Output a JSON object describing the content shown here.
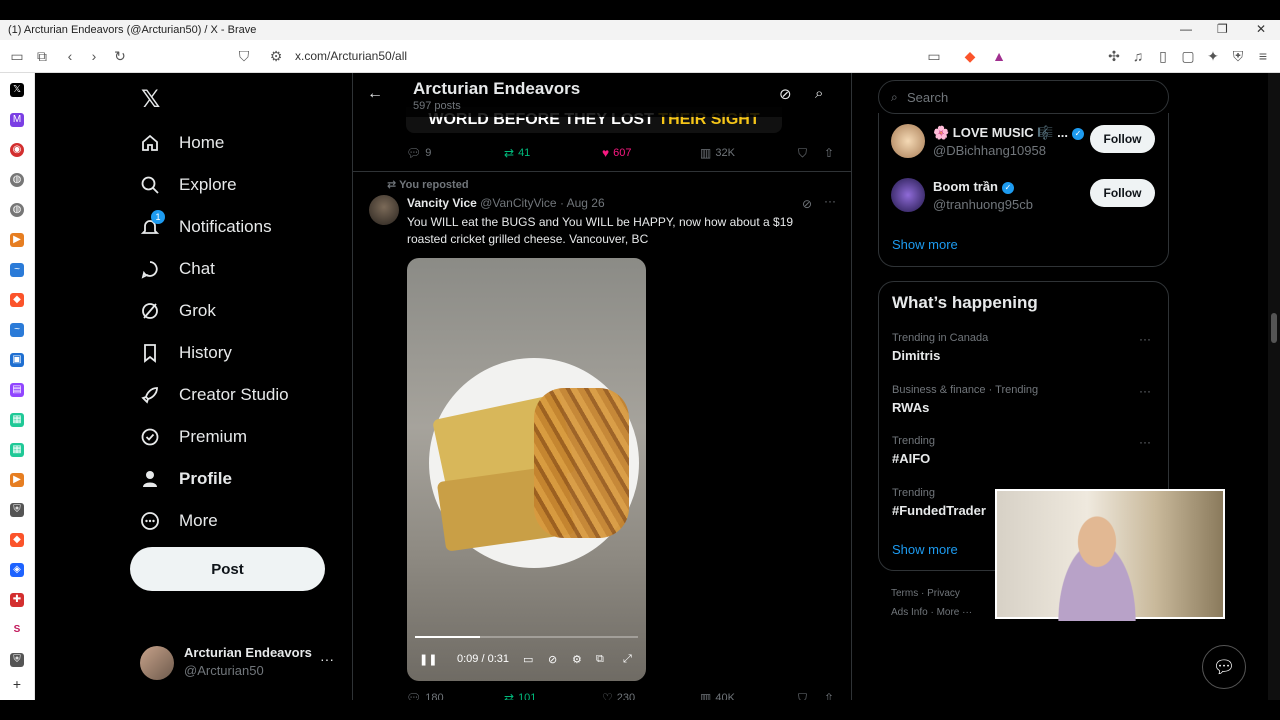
{
  "browser": {
    "window_title": "(1) Arcturian Endeavors (@Arcturian50) / X - Brave",
    "url": "x.com/Arcturian50/all"
  },
  "nav": {
    "items": [
      {
        "label": "Home",
        "icon": "home-icon"
      },
      {
        "label": "Explore",
        "icon": "search-icon"
      },
      {
        "label": "Notifications",
        "icon": "bell-icon",
        "badge": "1"
      },
      {
        "label": "Chat",
        "icon": "chat-icon"
      },
      {
        "label": "Grok",
        "icon": "grok-icon"
      },
      {
        "label": "History",
        "icon": "bookmark-icon"
      },
      {
        "label": "Creator Studio",
        "icon": "rocket-icon"
      },
      {
        "label": "Premium",
        "icon": "verified-badge-icon"
      },
      {
        "label": "Profile",
        "icon": "person-icon"
      },
      {
        "label": "More",
        "icon": "more-circle-icon"
      }
    ],
    "post_label": "Post",
    "account": {
      "name": "Arcturian Endeavors",
      "handle": "@Arcturian50"
    }
  },
  "profile_header": {
    "name": "Arcturian Endeavors",
    "post_count": "597 posts"
  },
  "prev_tweet": {
    "banner_text": "WORLD BEFORE THEY LOST ",
    "banner_highlight": "THEIR SIGHT",
    "replies": "9",
    "reposts": "41",
    "likes": "607",
    "views": "32K"
  },
  "tweet": {
    "repost_label": "You reposted",
    "author_name": "Vancity Vice",
    "author_handle": "@VanCityVice",
    "date": "· Aug 26",
    "text": "You WILL eat the BUGS and You WILL be HAPPY, now how about a $19 roasted cricket grilled cheese. Vancouver, BC",
    "video_time": "0:09 / 0:31",
    "video_progress": 0.29,
    "replies": "180",
    "reposts": "101",
    "likes": "230",
    "views": "40K"
  },
  "search": {
    "placeholder": "Search"
  },
  "who_to_follow": {
    "items": [
      {
        "name": "🌸 LOVE MUSIC 🎼 ...",
        "handle": "@DBichhang10958",
        "follow": "Follow"
      },
      {
        "name": "Boom trần",
        "handle": "@tranhuong95cb",
        "follow": "Follow"
      }
    ],
    "show_more": "Show more"
  },
  "whats_happening": {
    "title": "What’s happening",
    "trends": [
      {
        "context": "Trending in Canada",
        "topic": "Dimitris"
      },
      {
        "context": "Business & finance · Trending",
        "topic": "RWAs"
      },
      {
        "context": "Trending",
        "topic": "#AIFO"
      },
      {
        "context": "Trending",
        "topic": "#FundedTrader"
      }
    ],
    "show_more": "Show more"
  },
  "footer": {
    "row1": "Terms · Privacy",
    "row2": "Ads Info · More ···"
  },
  "colors": {
    "accent": "#1d9bf0",
    "repost_green": "#00ba7c",
    "like_pink": "#f91880"
  }
}
